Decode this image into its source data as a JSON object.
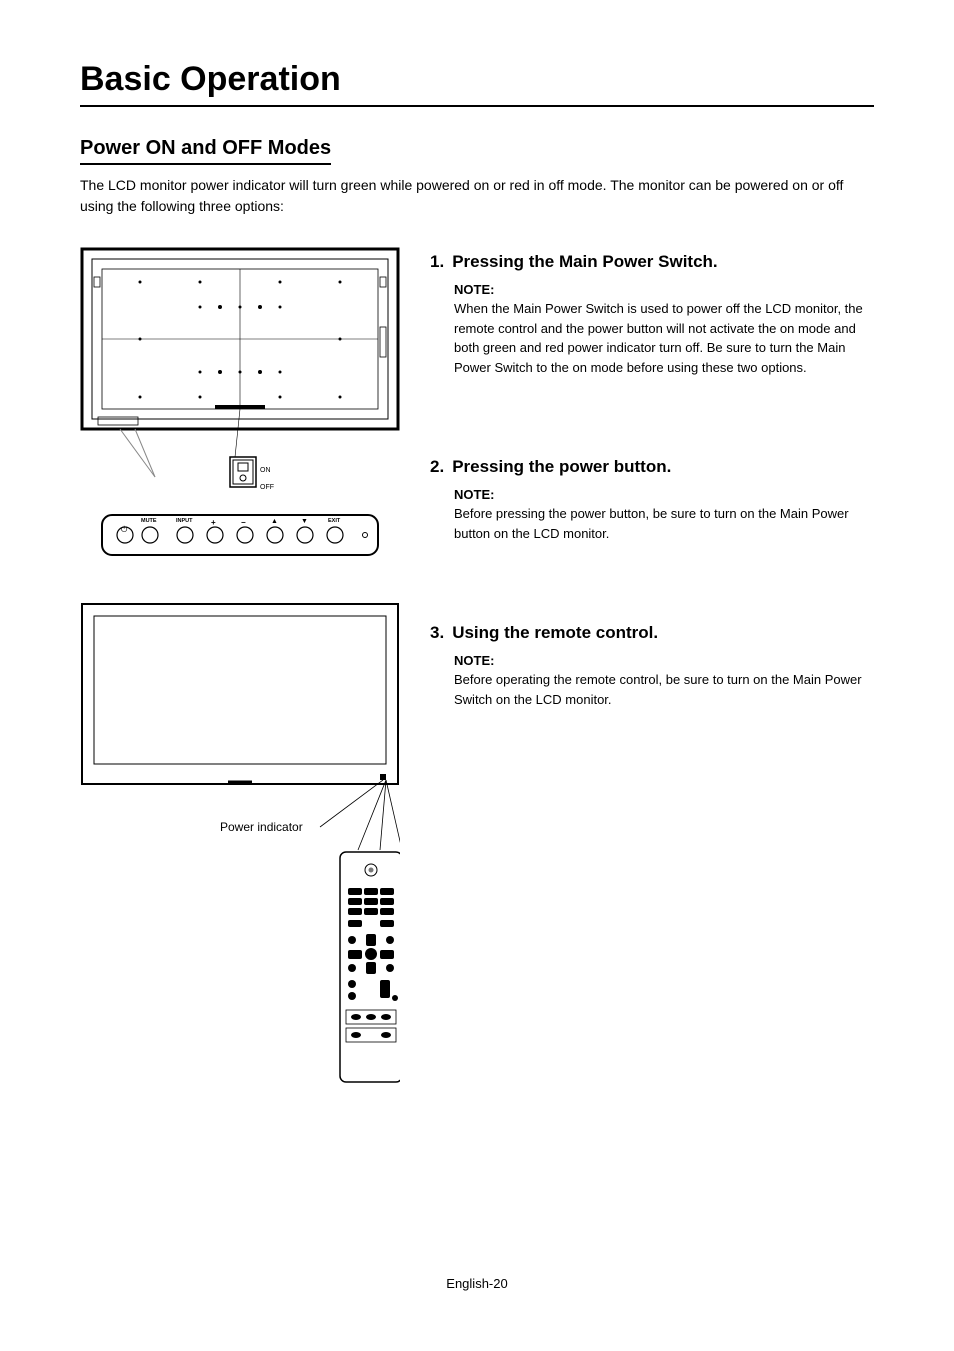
{
  "title": "Basic Operation",
  "section_heading": "Power ON and OFF Modes",
  "intro": "The LCD monitor power indicator will turn green while powered on or red in off mode. The monitor can be powered on or off using the following three options:",
  "methods": [
    {
      "num": "1.",
      "heading": "Pressing the Main Power Switch.",
      "note_label": "NOTE:",
      "note_text": "When the Main Power Switch is used to power off the LCD monitor, the remote control and the power button will not  activate the on mode and both green and red power indicator turn off.  Be sure to turn the Main Power Switch to the on mode before using these two options."
    },
    {
      "num": "2.",
      "heading": "Pressing the power button.",
      "note_label": "NOTE:",
      "note_text": "Before pressing the power button, be sure to turn on the Main Power button on the LCD monitor."
    },
    {
      "num": "3.",
      "heading": "Using the remote control.",
      "note_label": "NOTE:",
      "note_text": "Before operating the remote control, be sure to turn on the Main Power Switch on the LCD monitor."
    }
  ],
  "diagram": {
    "switch_on": "ON",
    "switch_off": "OFF",
    "button_power_icon": "⏻",
    "button_mute": "MUTE",
    "button_input": "INPUT",
    "button_plus": "+",
    "button_minus": "−",
    "button_up": "▲",
    "button_down": "▼",
    "button_exit": "EXIT",
    "power_indicator_label": "Power indicator"
  },
  "footer": "English-20"
}
